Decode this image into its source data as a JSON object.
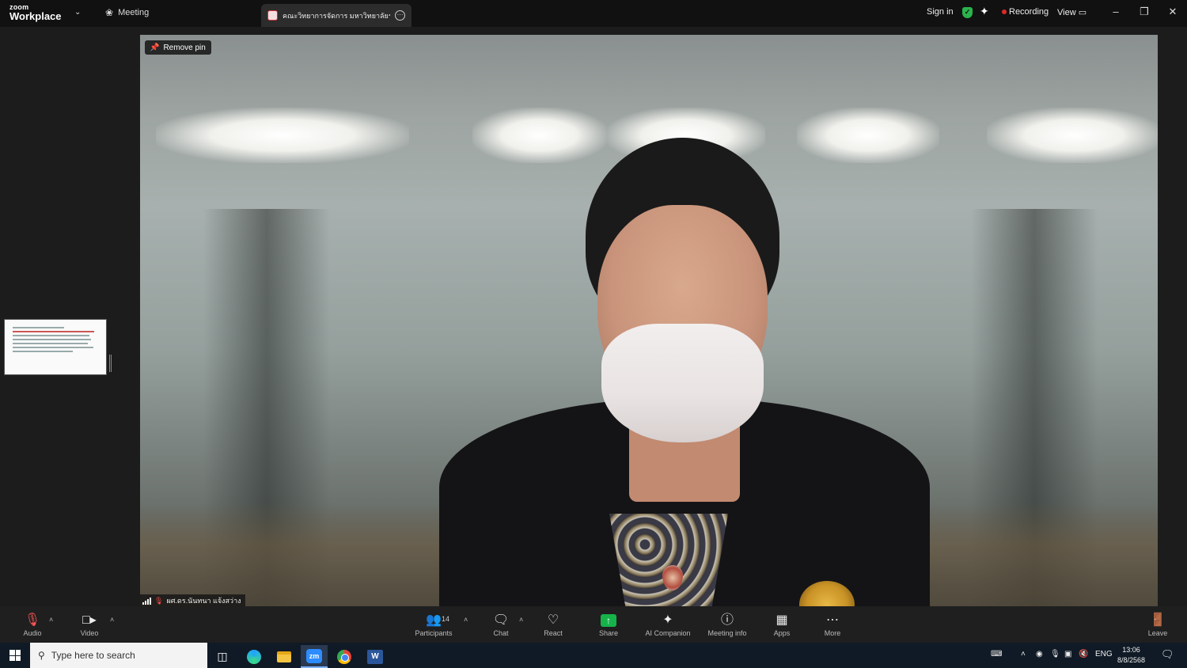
{
  "app": {
    "brand_top": "zoom",
    "brand_bottom": "Workplace",
    "meeting_tab": "Meeting",
    "active_tab_title": "คณะวิทยาการจัดการ มหาวิทยาลัยราชภัฏ",
    "sign_in": "Sign in",
    "recording": "Recording",
    "view": "View"
  },
  "stage": {
    "remove_pin": "Remove pin",
    "participant_name": "ผศ.ดร.นันทนา แจ้งสว่าง"
  },
  "toolbar": {
    "audio": "Audio",
    "video": "Video",
    "participants": "Participants",
    "participant_count": "14",
    "chat": "Chat",
    "react": "React",
    "share": "Share",
    "ai_companion": "AI Companion",
    "meeting_info": "Meeting info",
    "apps": "Apps",
    "more": "More",
    "leave": "Leave"
  },
  "taskbar": {
    "search_placeholder": "Type here to search",
    "zoom_label": "zm",
    "word_label": "W",
    "language": "ENG",
    "time": "13:06",
    "date": "8/8/2568"
  },
  "icons": {
    "shield": "shield-check-icon",
    "sparkle": "ai-sparkle-icon",
    "recording_dot_color": "#e02828",
    "share_color": "#16b34a"
  }
}
